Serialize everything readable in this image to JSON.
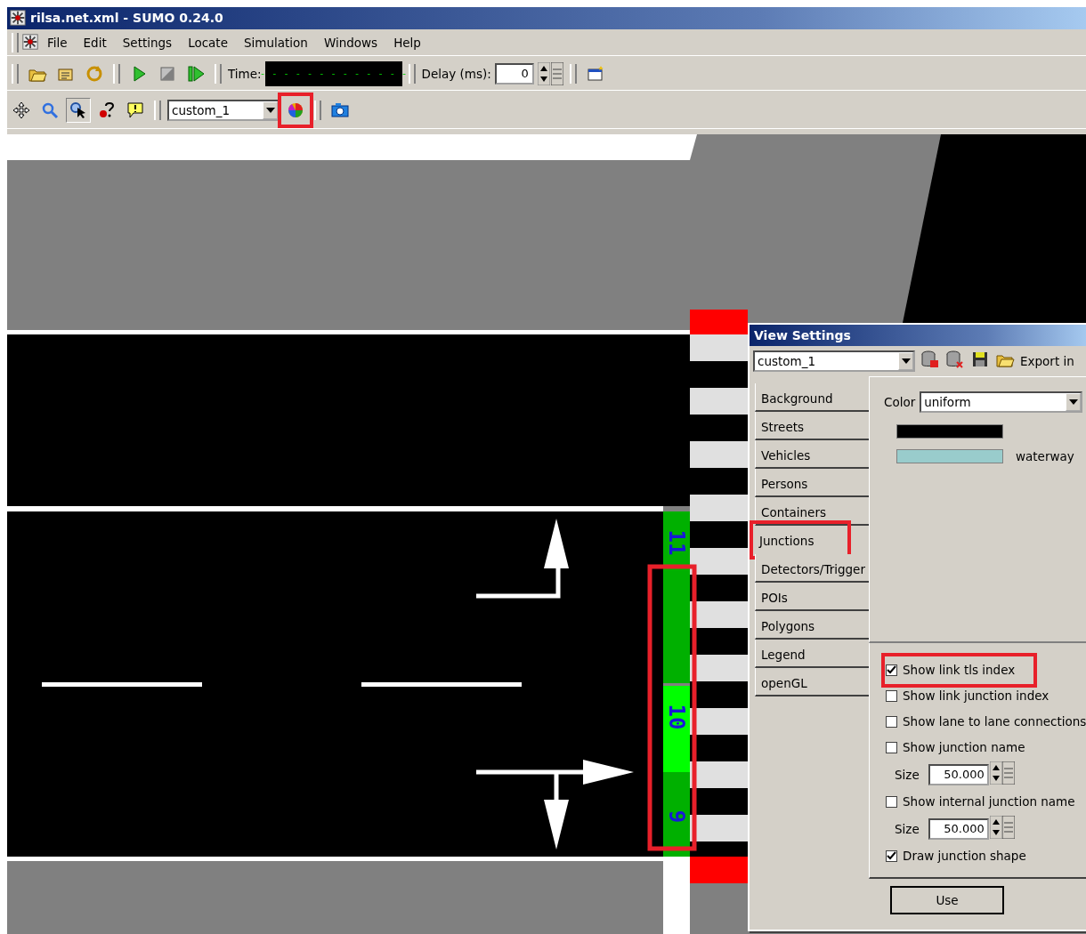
{
  "window": {
    "title": "rilsa.net.xml - SUMO 0.24.0"
  },
  "menu": [
    {
      "label": "File"
    },
    {
      "label": "Edit"
    },
    {
      "label": "Settings"
    },
    {
      "label": "Locate"
    },
    {
      "label": "Simulation"
    },
    {
      "label": "Windows"
    },
    {
      "label": "Help"
    }
  ],
  "sim_toolbar": {
    "time_label": "Time:",
    "time_display": "- - - - - - - - - - - - -",
    "delay_label": "Delay (ms):",
    "delay_value": "0"
  },
  "view_toolbar": {
    "scheme": "custom_1",
    "color_button_highlighted": true
  },
  "canvas": {
    "signals": [
      {
        "label": "11",
        "color": "#00b000"
      },
      {
        "label": "10",
        "color": "#00ff00"
      },
      {
        "label": "9",
        "color": "#00b000"
      }
    ],
    "signals_highlighted": true
  },
  "dialog": {
    "title": "View Settings",
    "scheme": "custom_1",
    "export_label": "Export in",
    "tabs": [
      {
        "label": "Background",
        "selected": false,
        "highlighted": false
      },
      {
        "label": "Streets",
        "selected": false,
        "highlighted": false
      },
      {
        "label": "Vehicles",
        "selected": false,
        "highlighted": false
      },
      {
        "label": "Persons",
        "selected": false,
        "highlighted": false
      },
      {
        "label": "Containers",
        "selected": false,
        "highlighted": false
      },
      {
        "label": "Junctions",
        "selected": true,
        "highlighted": true
      },
      {
        "label": "Detectors/Trigger",
        "selected": false,
        "highlighted": false
      },
      {
        "label": "POIs",
        "selected": false,
        "highlighted": false
      },
      {
        "label": "Polygons",
        "selected": false,
        "highlighted": false
      },
      {
        "label": "Legend",
        "selected": false,
        "highlighted": false
      },
      {
        "label": "openGL",
        "selected": false,
        "highlighted": false
      }
    ],
    "color_label": "Color",
    "color_mode": "uniform",
    "swatches": [
      {
        "color": "#000000"
      },
      {
        "color": "#99cccc",
        "label": "waterway"
      }
    ],
    "options": [
      {
        "kind": "checkbox",
        "label": "Show link tls index",
        "checked": true,
        "highlighted": true
      },
      {
        "kind": "checkbox",
        "label": "Show link junction index",
        "checked": false,
        "highlighted": false
      },
      {
        "kind": "checkbox",
        "label": "Show lane to lane connections",
        "checked": false,
        "highlighted": false
      },
      {
        "kind": "checkbox",
        "label": "Show junction name",
        "checked": false,
        "highlighted": false
      },
      {
        "kind": "size",
        "label": "Size",
        "value": "50.000"
      },
      {
        "kind": "checkbox",
        "label": "Show internal junction name",
        "checked": false,
        "highlighted": false
      },
      {
        "kind": "size",
        "label": "Size",
        "value": "50.000"
      },
      {
        "kind": "checkbox",
        "label": "Draw junction shape",
        "checked": true,
        "highlighted": false
      }
    ],
    "button": {
      "label": "Use"
    }
  }
}
